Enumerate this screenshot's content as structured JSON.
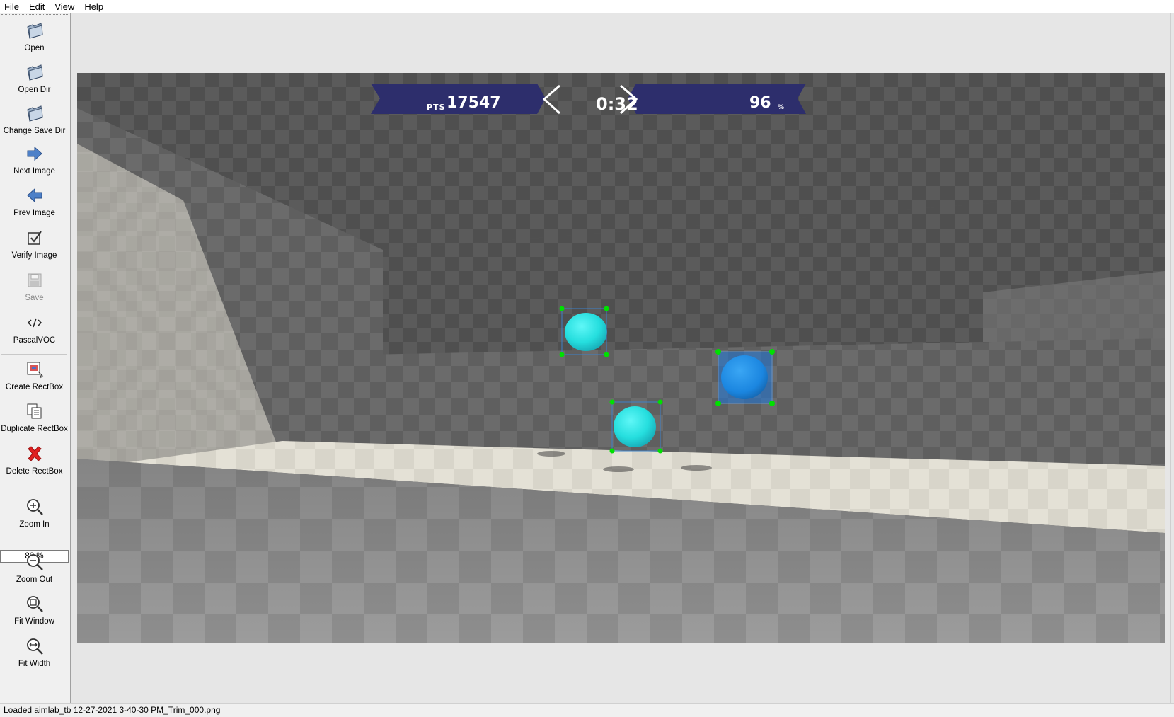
{
  "menu": [
    "File",
    "Edit",
    "View",
    "Help"
  ],
  "toolbar": {
    "open": "Open",
    "open_dir": "Open Dir",
    "change_save_dir": "Change Save Dir",
    "next_image": "Next Image",
    "prev_image": "Prev Image",
    "verify_image": "Verify Image",
    "save": "Save",
    "format": "PascalVOC",
    "create_rectbox": "Create RectBox",
    "duplicate_rectbox": "Duplicate RectBox",
    "delete_rectbox": "Delete RectBox",
    "zoom_in": "Zoom In",
    "zoom_value": "80 %",
    "zoom_out": "Zoom Out",
    "fit_window": "Fit Window",
    "fit_width": "Fit Width"
  },
  "hud": {
    "pts_label": "PTS",
    "score": "17547",
    "timer": "0:32",
    "accuracy": "96",
    "accuracy_unit": "%"
  },
  "annotations": {
    "box_color": "#3c82c8",
    "selected_fill": "#1e78dc",
    "vertex_color": "#00e000",
    "target_color": "#27e0e0"
  },
  "status": {
    "text": "Loaded aimlab_tb 12-27-2021 3-40-30 PM_Trim_000.png"
  }
}
